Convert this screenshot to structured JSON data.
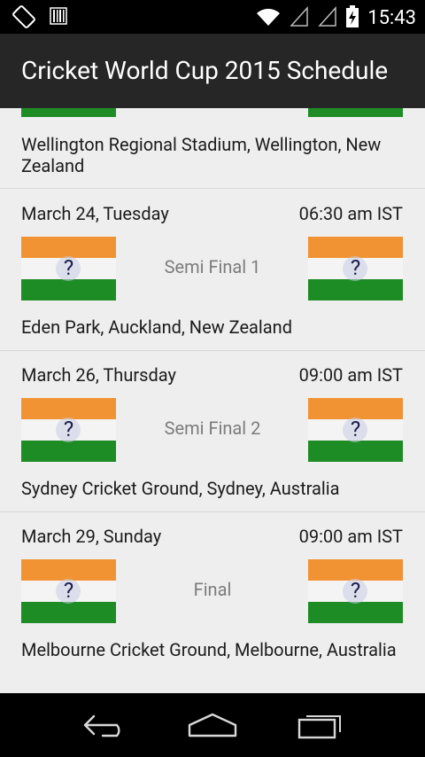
{
  "status_bar": {
    "time": "15:43",
    "icons": [
      "screen-rotation-icon",
      "barcode-icon",
      "wifi-icon",
      "signal-icon",
      "signal-icon",
      "battery-charging-icon"
    ]
  },
  "app": {
    "title": "Cricket World Cup 2015 Schedule"
  },
  "top_partial": {
    "venue": "Wellington Regional Stadium, Wellington, New Zealand"
  },
  "matches": [
    {
      "date": "March 24, Tuesday",
      "time": "06:30 am IST",
      "round": "Semi Final 1",
      "team_left": "?",
      "team_right": "?",
      "venue": "Eden Park, Auckland, New Zealand"
    },
    {
      "date": "March 26, Thursday",
      "time": "09:00 am IST",
      "round": "Semi Final 2",
      "team_left": "?",
      "team_right": "?",
      "venue": "Sydney Cricket Ground, Sydney, Australia"
    },
    {
      "date": "March 29, Sunday",
      "time": "09:00 am IST",
      "round": "Final",
      "team_left": "?",
      "team_right": "?",
      "venue": "Melbourne Cricket Ground, Melbourne, Australia"
    }
  ],
  "colors": {
    "saffron": "#f29333",
    "white": "#f4f4f4",
    "green": "#1e8c25",
    "action_bar": "#262626"
  },
  "nav_bar": {
    "icons": [
      "back-icon",
      "home-icon",
      "recent-apps-icon"
    ]
  }
}
